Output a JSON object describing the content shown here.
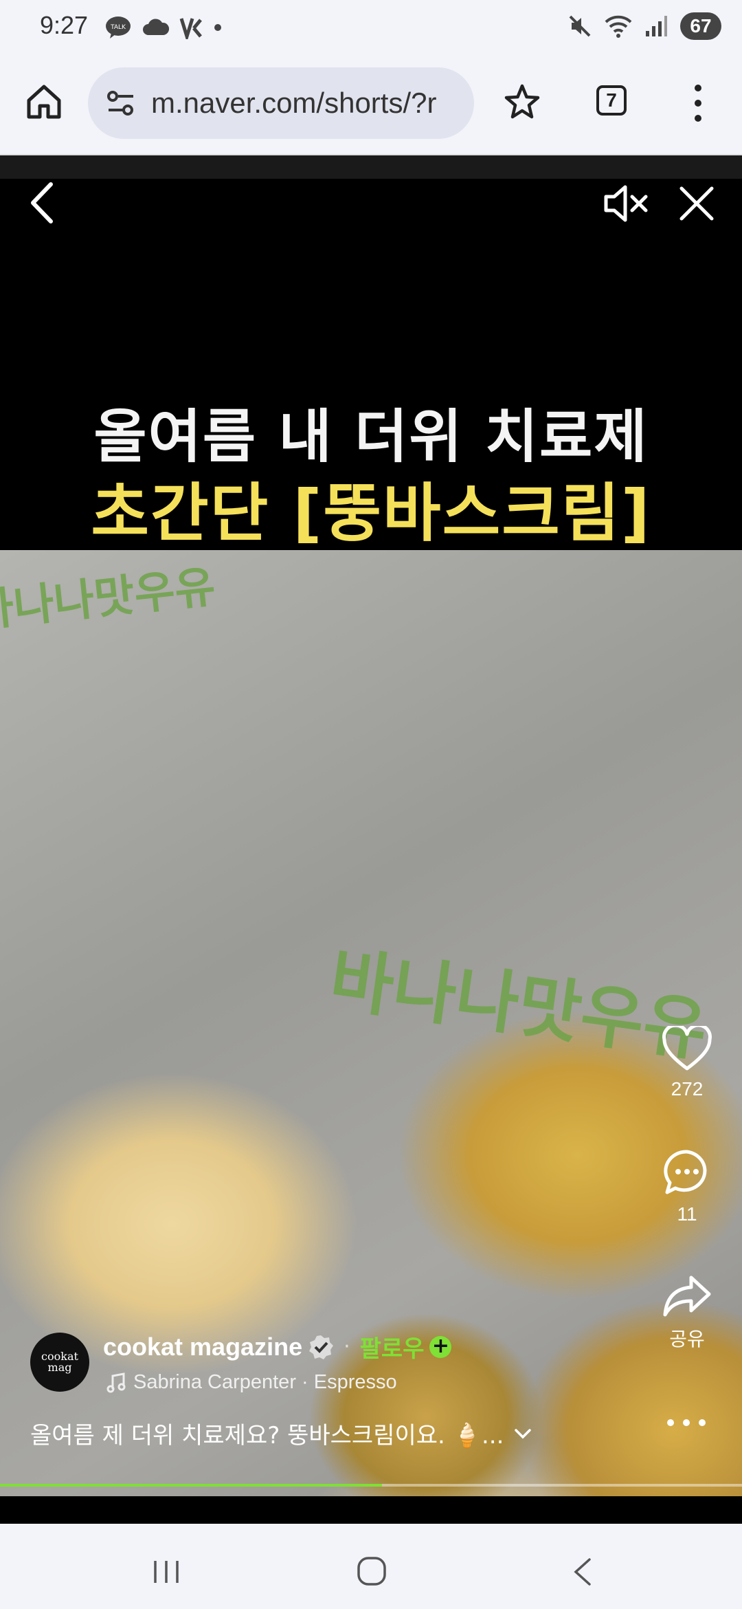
{
  "status_bar": {
    "time": "9:27",
    "battery": "67",
    "left_icons": [
      "kakaotalk-icon",
      "cloud-icon",
      "vpn-icon",
      "dot-icon"
    ],
    "right_icons": [
      "mute-icon",
      "wifi-icon",
      "signal-icon",
      "battery-icon"
    ]
  },
  "browser": {
    "url": "m.naver.com/shorts/?r",
    "tab_count": "7"
  },
  "video": {
    "caption_line1": "올여름 내 더위 치료제",
    "caption_line2": "초간단 [뚱바스크림]",
    "cup_text": "바나나맛우유",
    "like_count": "272",
    "comment_count": "11",
    "share_label": "공유",
    "progress": 0.515,
    "accent_color": "#7fe036"
  },
  "channel": {
    "avatar_text": "cookat mag",
    "name": "cookat magazine",
    "separator": "·",
    "follow_label": "팔로우",
    "music": "Sabrina Carpenter · Espresso",
    "description": "올여름 제 더위 치료제요? 뚱바스크림이요. 🍦..."
  }
}
